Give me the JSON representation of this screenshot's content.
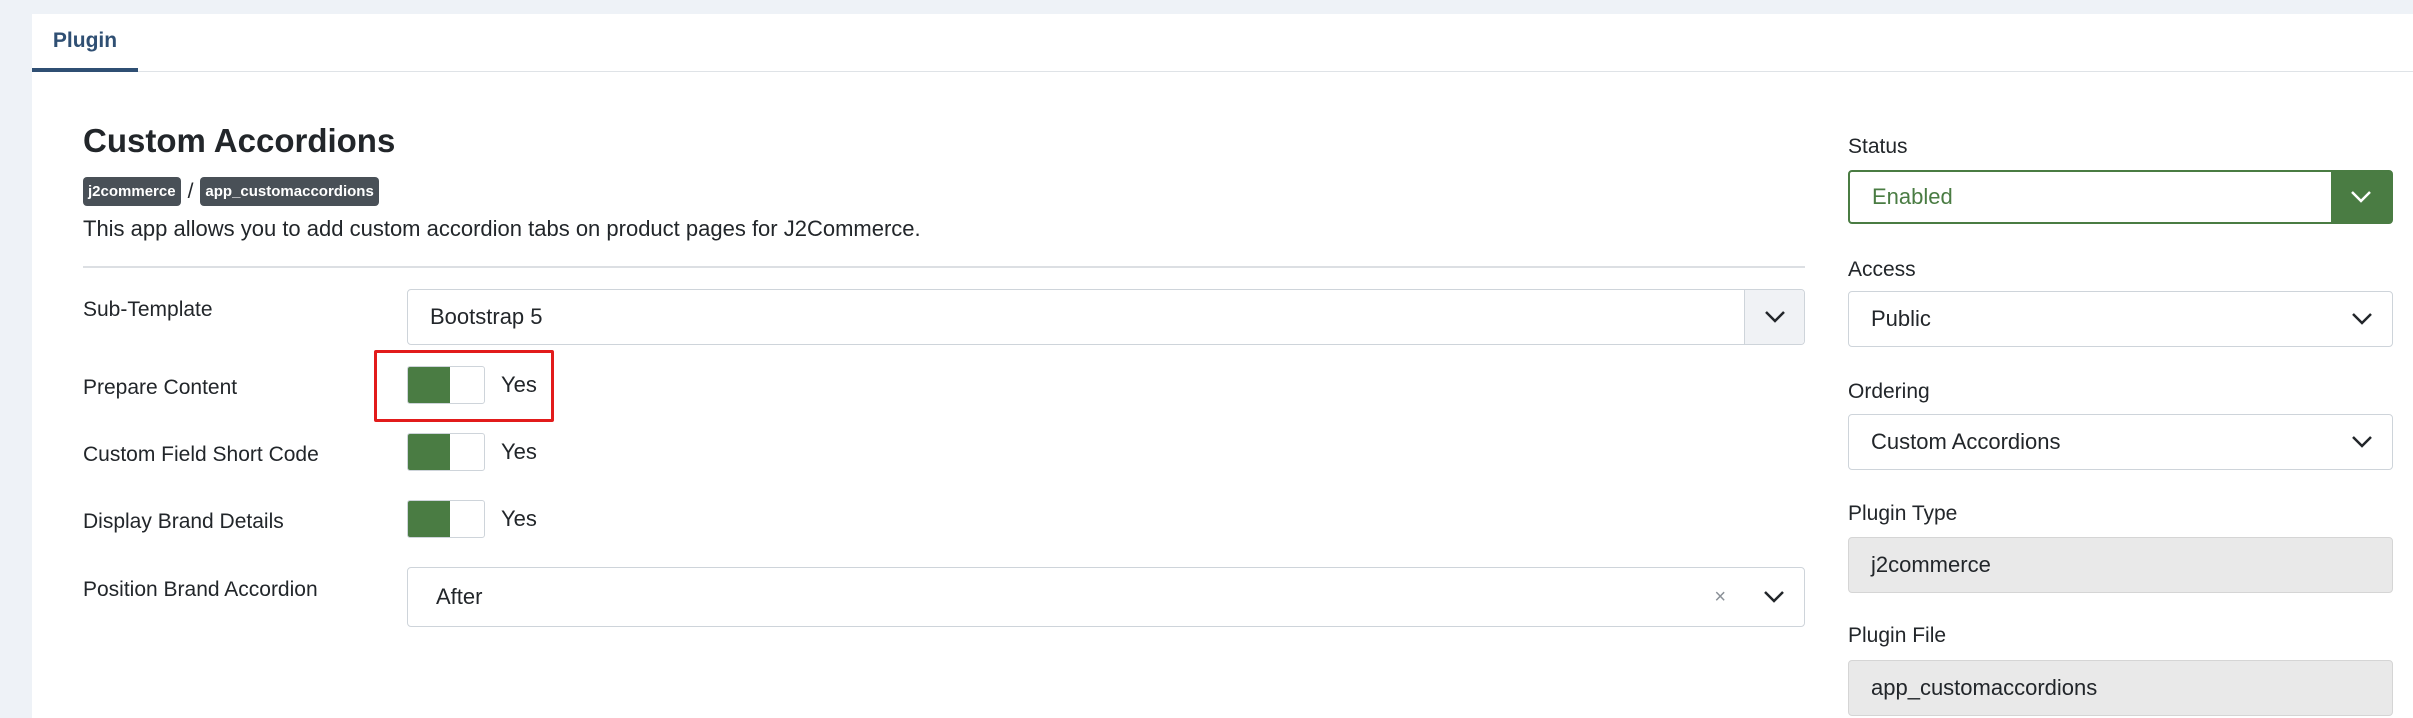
{
  "tabs": [
    {
      "label": "Plugin"
    }
  ],
  "plugin": {
    "title": "Custom Accordions",
    "badges": [
      "j2commerce",
      "app_customaccordions"
    ],
    "badge_separator": "/",
    "description": "This app allows you to add custom accordion tabs on product pages for J2Commerce."
  },
  "fields": {
    "sub_template": {
      "label": "Sub-Template",
      "value": "Bootstrap 5"
    },
    "prepare_content": {
      "label": "Prepare Content",
      "value": "Yes",
      "on": true
    },
    "custom_field_short_code": {
      "label": "Custom Field Short Code",
      "value": "Yes",
      "on": true
    },
    "display_brand_details": {
      "label": "Display Brand Details",
      "value": "Yes",
      "on": true
    },
    "position_brand_accordion": {
      "label": "Position Brand Accordion",
      "value": "After",
      "clear": "×"
    }
  },
  "sidebar": {
    "status": {
      "label": "Status",
      "value": "Enabled"
    },
    "access": {
      "label": "Access",
      "value": "Public"
    },
    "ordering": {
      "label": "Ordering",
      "value": "Custom Accordions"
    },
    "plugin_type": {
      "label": "Plugin Type",
      "value": "j2commerce"
    },
    "plugin_file": {
      "label": "Plugin File",
      "value": "app_customaccordions"
    }
  },
  "colors": {
    "accent": "#4a7c43",
    "tab": "#2f4f73",
    "highlight": "#e21b1b"
  },
  "icons": {
    "select_arrow": "chevron-down-icon",
    "clear": "close-icon"
  }
}
